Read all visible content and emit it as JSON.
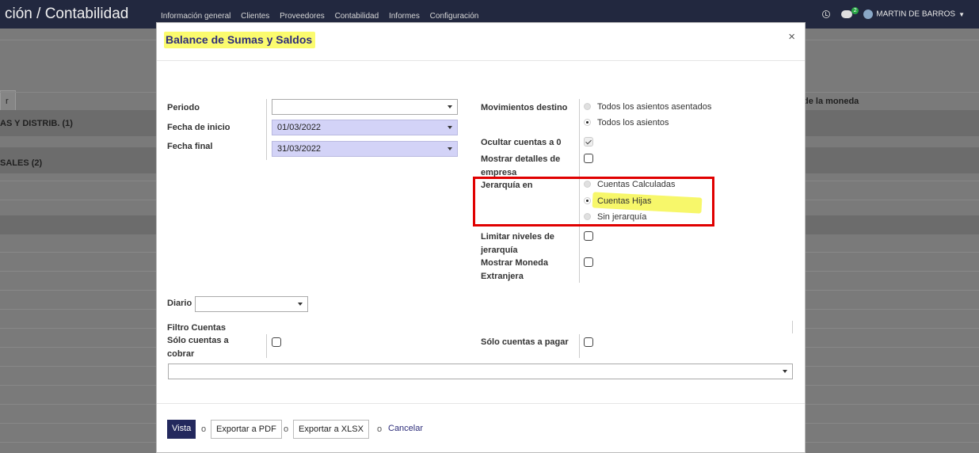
{
  "navbar": {
    "app_title": "ción / Contabilidad",
    "menu": [
      "Información general",
      "Clientes",
      "Proveedores",
      "Contabilidad",
      "Informes",
      "Configuración"
    ],
    "chat_count": "2",
    "user_name": "MARTIN DE BARROS"
  },
  "background": {
    "button_label": "r",
    "column_header": "de la moneda",
    "group_1": "AS Y DISTRIB. (1)",
    "group_2": "SALES (2)"
  },
  "modal": {
    "title": "Balance de Sumas y Saldos",
    "close_label": "×",
    "periodo_label": "Periodo",
    "periodo_value": "",
    "fecha_inicio_label": "Fecha de inicio",
    "fecha_inicio_value": "01/03/2022",
    "fecha_final_label": "Fecha final",
    "fecha_final_value": "31/03/2022",
    "movimientos_label": "Movimientos destino",
    "movimientos_options": [
      "Todos los asientos asentados",
      "Todos los asientos"
    ],
    "movimientos_selected": 1,
    "ocultar_label": "Ocultar cuentas a 0",
    "ocultar_checked": true,
    "detalles_label": "Mostrar detalles de empresa",
    "detalles_checked": false,
    "jerarquia_label": "Jerarquía en",
    "jerarquia_options": [
      "Cuentas Calculadas",
      "Cuentas Hijas",
      "Sin jerarquía"
    ],
    "jerarquia_selected": 1,
    "limitar_label": "Limitar niveles de jerarquía",
    "limitar_checked": false,
    "moneda_label": "Mostrar Moneda Extranjera",
    "moneda_checked": false,
    "diario_label": "Diario",
    "diario_value": "",
    "filtro_label": "Filtro Cuentas",
    "cobrar_label": "Sólo cuentas a cobrar",
    "cobrar_checked": false,
    "pagar_label": "Sólo cuentas a pagar",
    "pagar_checked": false,
    "cuentas_value": "",
    "buttons": {
      "vista": "Vista",
      "or": "o",
      "pdf": "Exportar a PDF",
      "xlsx": "Exportar a XLSX",
      "cancel": "Cancelar"
    }
  },
  "colors": {
    "navbar_bg": "#22283f",
    "primary": "#23285d",
    "highlight": "#f7f76a",
    "annotation_red": "#e00000",
    "date_field_bg": "#d3d3f7"
  }
}
